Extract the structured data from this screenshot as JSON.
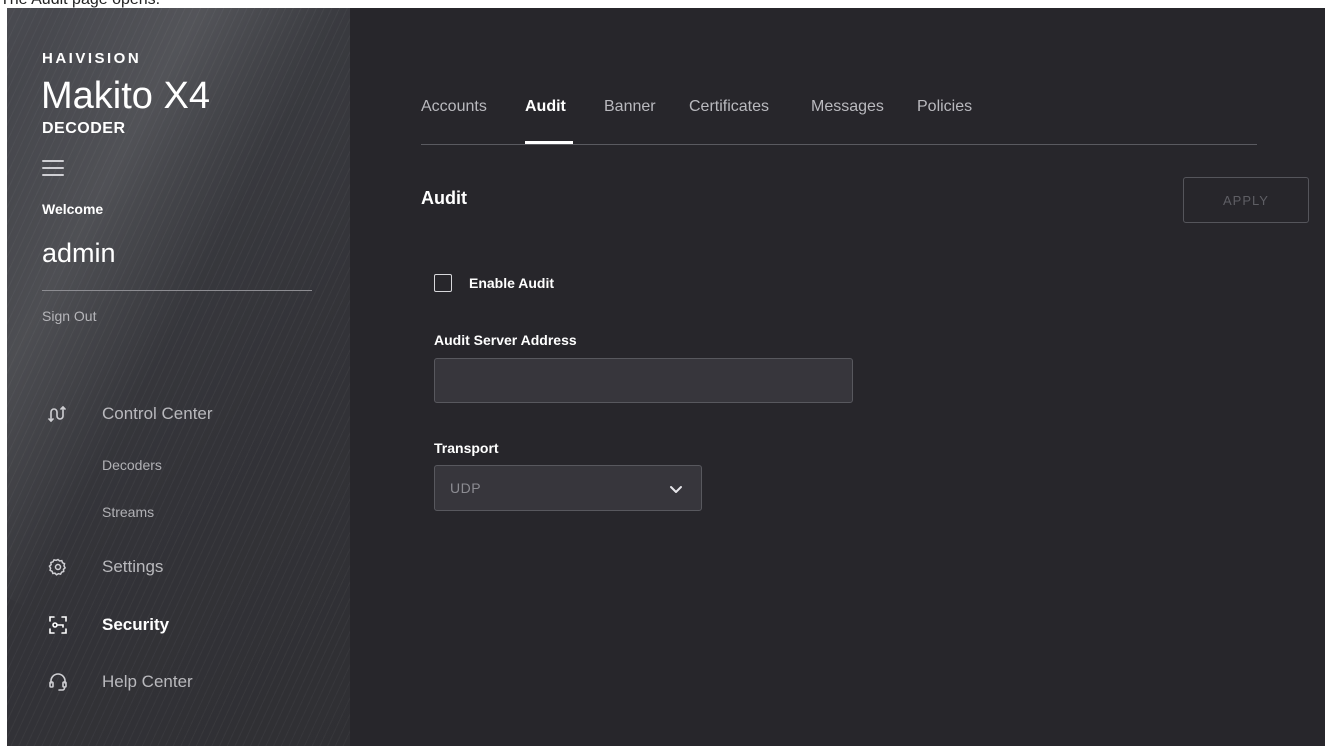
{
  "caption": "The Audit page opens.",
  "brand": {
    "company": "HAIVISION",
    "product": "Makito X4",
    "product_sub": "DECODER"
  },
  "user": {
    "welcome": "Welcome",
    "username": "admin",
    "sign_out": "Sign Out"
  },
  "nav": {
    "control_center": "Control Center",
    "decoders": "Decoders",
    "streams": "Streams",
    "settings": "Settings",
    "security": "Security",
    "help_center": "Help Center",
    "active": "Security"
  },
  "tabs": [
    {
      "label": "Accounts",
      "active": false
    },
    {
      "label": "Audit",
      "active": true
    },
    {
      "label": "Banner",
      "active": false
    },
    {
      "label": "Certificates",
      "active": false
    },
    {
      "label": "Messages",
      "active": false
    },
    {
      "label": "Policies",
      "active": false
    }
  ],
  "section": {
    "title": "Audit",
    "apply_label": "APPLY"
  },
  "form": {
    "enable_audit_label": "Enable Audit",
    "enable_audit_checked": false,
    "server_address_label": "Audit Server Address",
    "server_address_value": "",
    "transport_label": "Transport",
    "transport_value": "UDP"
  },
  "colors": {
    "background": "#27262b",
    "sidebar": "#3a3b40",
    "input_bg": "#37363c",
    "text_primary": "#ffffff",
    "text_muted": "#b9b9bd",
    "disabled": "#5e5e64"
  }
}
